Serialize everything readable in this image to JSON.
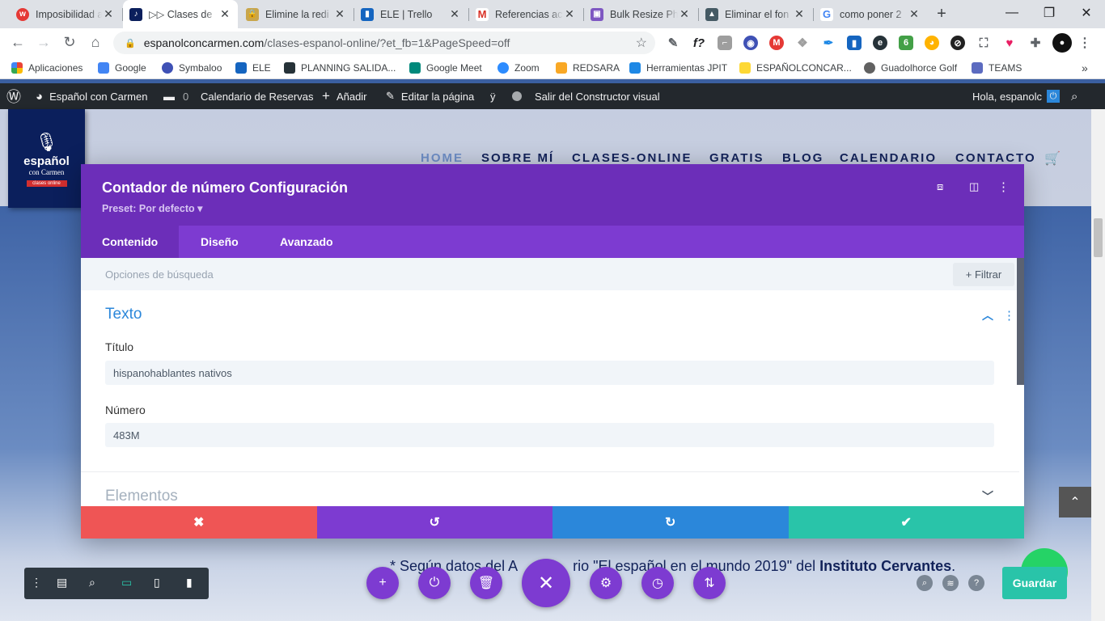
{
  "browser": {
    "tabs": [
      {
        "title": "Imposibilidad a",
        "icon": "red-circle-icon"
      },
      {
        "title": "▷▷ Clases de",
        "icon": "microphone-icon"
      },
      {
        "title": "Elimine la redi",
        "icon": "lock-icon"
      },
      {
        "title": "ELE | Trello",
        "icon": "trello-icon"
      },
      {
        "title": "Referencias act",
        "icon": "gmail-icon"
      },
      {
        "title": "Bulk Resize Ph",
        "icon": "image-stack-icon"
      },
      {
        "title": "Eliminar el fon",
        "icon": "graduation-cap-icon"
      },
      {
        "title": "como poner 2",
        "icon": "google-icon"
      }
    ],
    "new_tab": "+",
    "url_domain": "espanolconcarmen.com",
    "url_path": "/clases-espanol-online/?et_fb=1&PageSpeed=off",
    "bookmarks": [
      {
        "label": "Aplicaciones",
        "color": "#ea4335"
      },
      {
        "label": "Google",
        "color": "#4285f4"
      },
      {
        "label": "Symbaloo",
        "color": "#3f51b5"
      },
      {
        "label": "ELE",
        "color": "#1565c0"
      },
      {
        "label": "PLANNING SALIDA...",
        "color": "#263238"
      },
      {
        "label": "Google Meet",
        "color": "#00897b"
      },
      {
        "label": "Zoom",
        "color": "#2d8cff"
      },
      {
        "label": "REDSARA",
        "color": "#f9a825"
      },
      {
        "label": "Herramientas JPIT",
        "color": "#1e88e5"
      },
      {
        "label": "ESPAÑOLCONCAR...",
        "color": "#fdd835"
      },
      {
        "label": "Guadolhorce Golf",
        "color": "#616161"
      },
      {
        "label": "TEAMS",
        "color": "#5c6bc0"
      }
    ],
    "more_bookmarks": "»"
  },
  "wp_admin": {
    "site_name": "Español con Carmen",
    "comments_count": "0",
    "calendar": "Calendario de Reservas",
    "add": "Añadir",
    "edit_page": "Editar la página",
    "exit_builder": "Salir del Constructor visual",
    "greeting": "Hola, espanolc"
  },
  "site": {
    "logo_title": "español",
    "logo_sub": "con Carmen",
    "logo_tag": "clases online",
    "menu": [
      "HOME",
      "SOBRE MÍ",
      "CLASES-ONLINE",
      "GRATIS",
      "BLOG",
      "CALENDARIO",
      "CONTACTO"
    ],
    "footnote_a": "* Según datos del A",
    "footnote_b": "rio \"El español en el mundo 2019\" del",
    "footnote_strong": "Instituto Cervantes",
    "footnote_end": "."
  },
  "modal": {
    "title": "Contador de número Configuración",
    "preset": "Preset: Por defecto ▾",
    "tabs": [
      "Contenido",
      "Diseño",
      "Avanzado"
    ],
    "search_placeholder": "Opciones de búsqueda",
    "filter_button": "+ Filtrar",
    "section_text": "Texto",
    "title_label": "Título",
    "title_value": "hispanohablantes nativos",
    "number_label": "Número",
    "number_value": "483M",
    "section_elements": "Elementos"
  },
  "builder": {
    "save": "Guardar"
  },
  "colors": {
    "modal_header": "#6c2eb9",
    "modal_tabs": "#7d3bd1",
    "cancel": "#ef5555",
    "undo": "#7d3bd1",
    "redo": "#2b87da",
    "confirm": "#29c4a9"
  }
}
